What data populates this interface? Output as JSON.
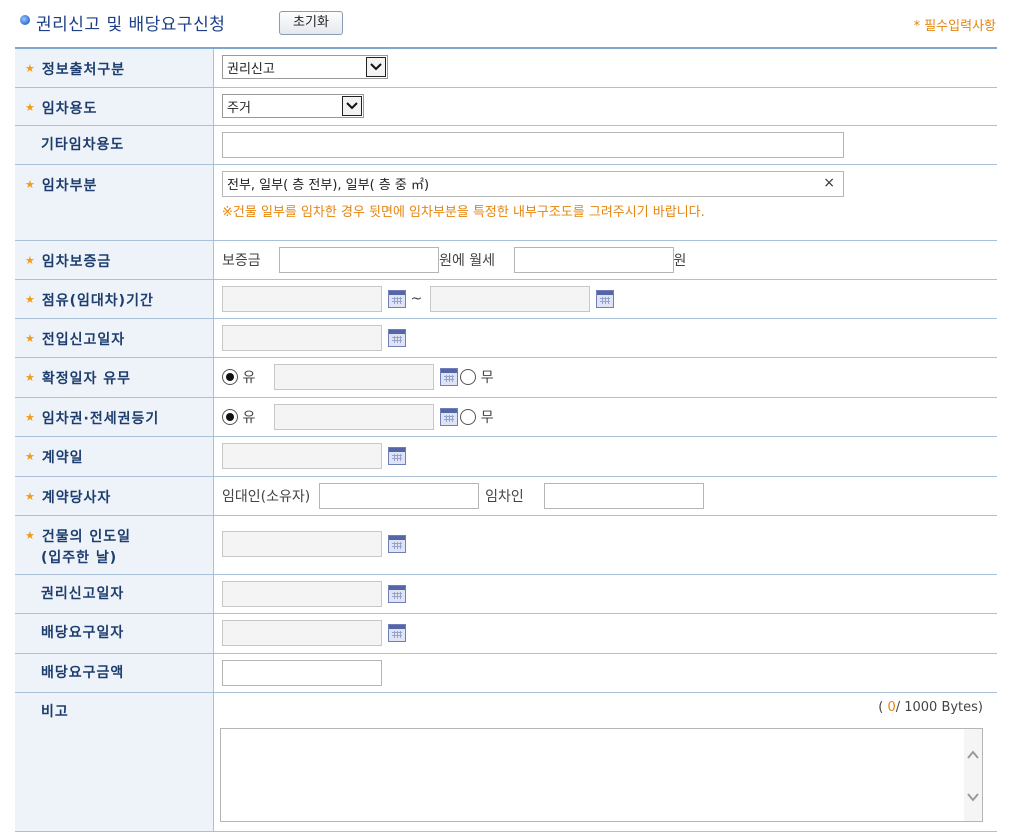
{
  "header": {
    "title": "권리신고 및 배당요구신청",
    "reset_label": "초기화",
    "required_note": "* 필수입력사항"
  },
  "rows": {
    "info_source": {
      "label": "정보출처구분",
      "value": "권리신고"
    },
    "lease_use": {
      "label": "임차용도",
      "value": "주거"
    },
    "other_lease_use": {
      "label": "기타임차용도",
      "value": ""
    },
    "lease_part": {
      "label": "임차부분",
      "value": "전부, 일부(   층 전부), 일부(   층 중   ㎡)",
      "clear": "×",
      "warning": "※건물 일부를 임차한 경우 뒷면에 임차부분을 특정한 내부구조도를 그려주시기 바랍니다."
    },
    "deposit": {
      "label": "임차보증금",
      "deposit_prefix": "보증금",
      "monthly_prefix": "원에 월세",
      "won_suffix": "원",
      "deposit_value": "",
      "monthly_value": ""
    },
    "occupancy_period": {
      "label": "점유(임대차)기간",
      "separator": "~"
    },
    "move_in_date": {
      "label": "전입신고일자"
    },
    "fixed_date": {
      "label": "확정일자 유무",
      "yes": "유",
      "no": "무"
    },
    "lease_registration": {
      "label": "임차권·전세권등기",
      "yes": "유",
      "no": "무"
    },
    "contract_date": {
      "label": "계약일"
    },
    "contract_parties": {
      "label": "계약당사자",
      "landlord": "임대인(소유자)",
      "tenant": "임차인"
    },
    "handover_date": {
      "label": "건물의 인도일",
      "label2": "(입주한 날)"
    },
    "claim_report_date": {
      "label": "권리신고일자"
    },
    "dividend_request_date": {
      "label": "배당요구일자"
    },
    "dividend_amount": {
      "label": "배당요구금액"
    },
    "remarks": {
      "label": "비고",
      "bytes_open": "(",
      "bytes_count": "0",
      "bytes_total": "/ 1000 Bytes)"
    }
  }
}
